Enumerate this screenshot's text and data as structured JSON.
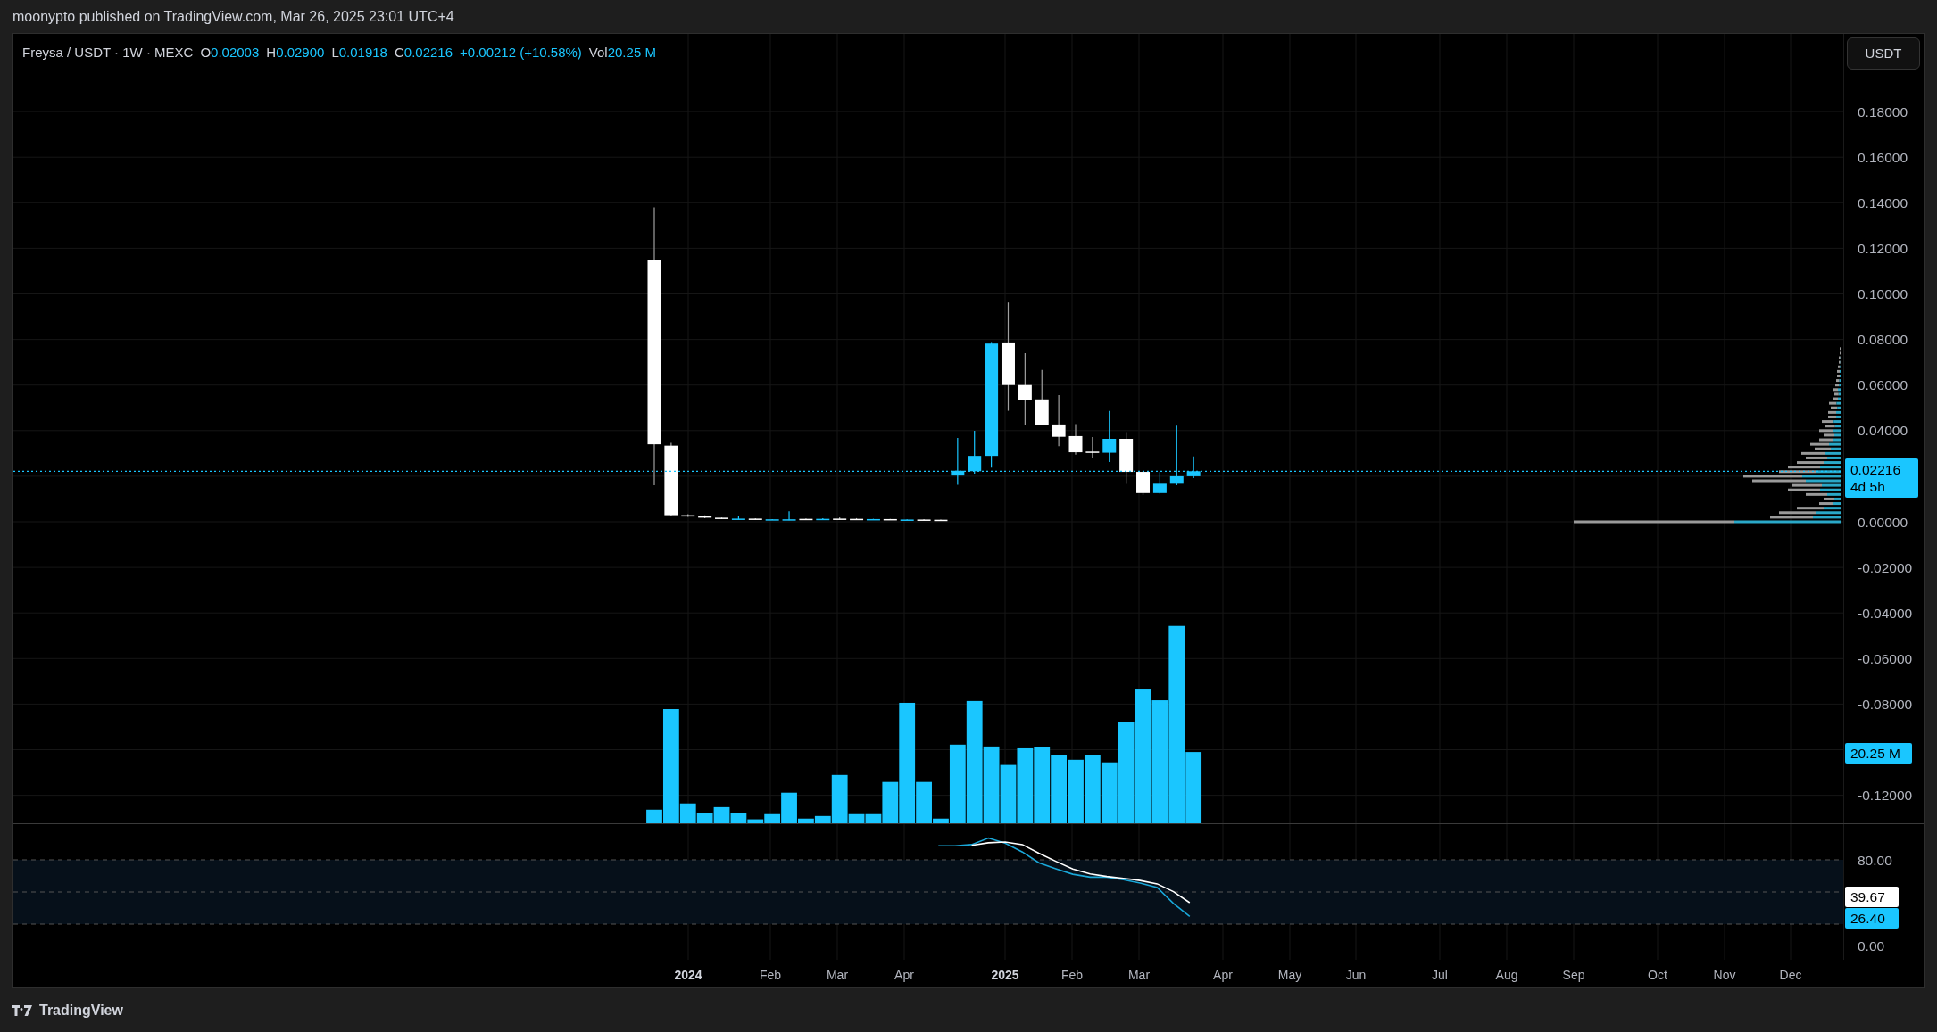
{
  "header": {
    "text": "moonypto published on TradingView.com, Mar 26, 2025 23:01 UTC+4"
  },
  "legend": {
    "symbol": "Freysa / USDT · 1W · MEXC",
    "fields": [
      {
        "label": "O",
        "value": "0.02003"
      },
      {
        "label": "H",
        "value": "0.02900"
      },
      {
        "label": "L",
        "value": "0.01918"
      },
      {
        "label": "C",
        "value": "0.02216"
      }
    ],
    "change": "+0.00212 (+10.58%)",
    "volume_label": "Vol",
    "volume_value": "20.25 M"
  },
  "currency_button": "USDT",
  "price_axis": {
    "ticks": [
      "0.18000",
      "0.16000",
      "0.14000",
      "0.12000",
      "0.10000",
      "0.08000",
      "0.06000",
      "0.04000",
      "0.00000",
      "-0.02000",
      "-0.04000",
      "-0.06000",
      "-0.08000",
      "-0.12000"
    ]
  },
  "price_tag": {
    "value": "0.02216",
    "countdown": "4d 5h"
  },
  "volume_tag": "20.25 M",
  "rsi_pane": {
    "ticks": [
      "80.00",
      "0.00"
    ],
    "ma_tag": "39.67",
    "rsi_tag": "26.40"
  },
  "time_axis": [
    {
      "label": "2024",
      "kind": "year"
    },
    {
      "label": "Feb",
      "kind": "month"
    },
    {
      "label": "Mar",
      "kind": "month"
    },
    {
      "label": "Apr",
      "kind": "month"
    },
    {
      "label": "2025",
      "kind": "year"
    },
    {
      "label": "Feb",
      "kind": "month"
    },
    {
      "label": "Mar",
      "kind": "month"
    },
    {
      "label": "Apr",
      "kind": "month"
    },
    {
      "label": "May",
      "kind": "month"
    },
    {
      "label": "Jun",
      "kind": "month"
    },
    {
      "label": "Jul",
      "kind": "month"
    },
    {
      "label": "Aug",
      "kind": "month"
    },
    {
      "label": "Sep",
      "kind": "month"
    },
    {
      "label": "Oct",
      "kind": "month"
    },
    {
      "label": "Nov",
      "kind": "month"
    },
    {
      "label": "Dec",
      "kind": "month"
    }
  ],
  "footer": {
    "brand": "TradingView"
  }
}
